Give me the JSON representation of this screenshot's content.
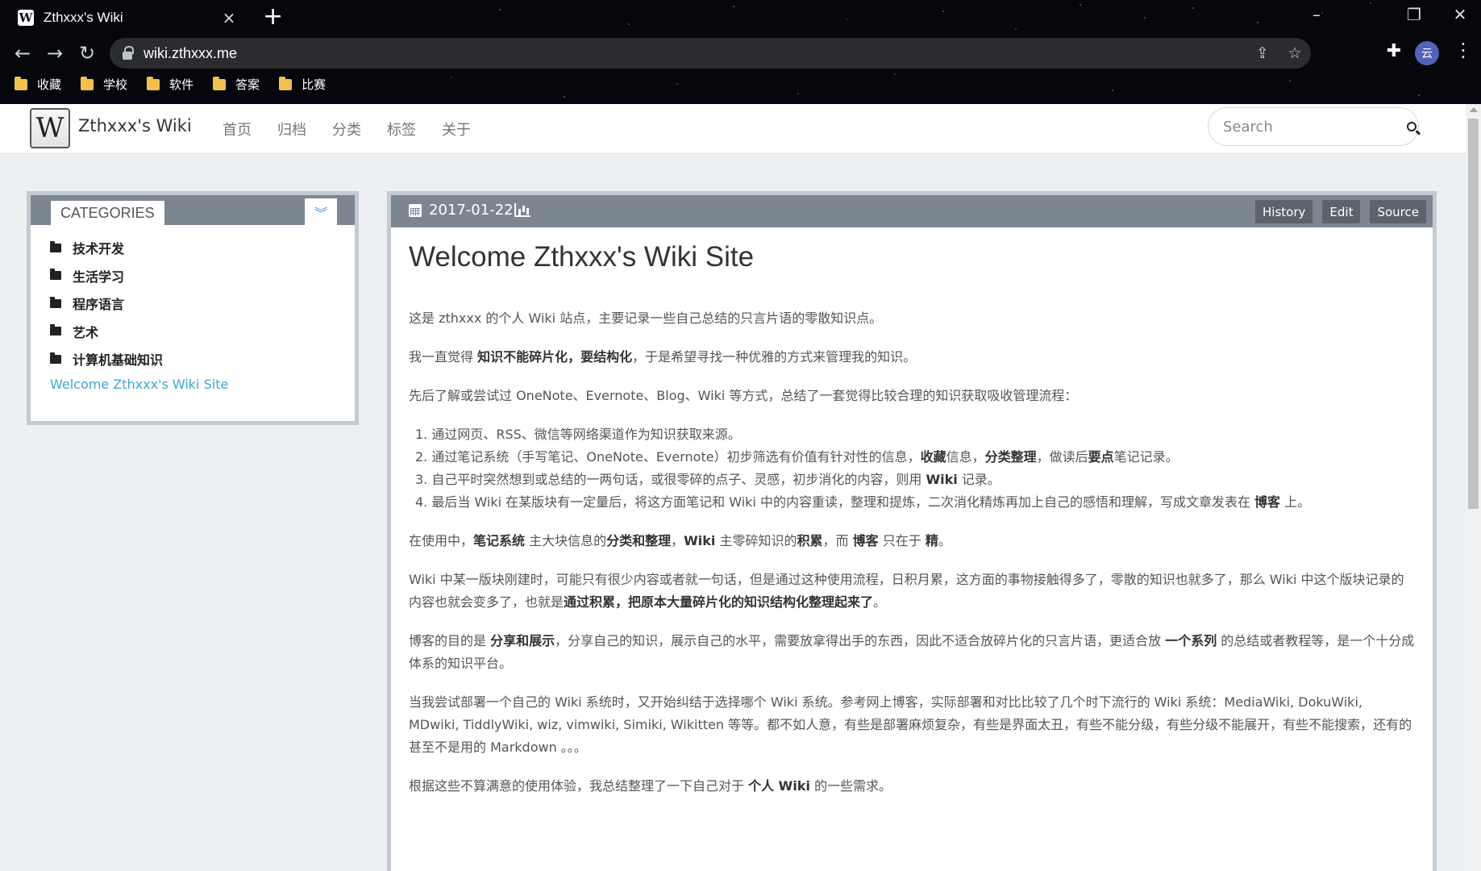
{
  "browser": {
    "tab_title": "Zthxxx's Wiki",
    "favicon": "W",
    "url": "wiki.zthxxx.me",
    "avatar_text": "云",
    "bookmarks": [
      "收藏",
      "学校",
      "软件",
      "答案",
      "比赛"
    ]
  },
  "header": {
    "logo": "W",
    "site_name": "Zthxxx's Wiki",
    "nav": [
      "首页",
      "归档",
      "分类",
      "标签",
      "关于"
    ],
    "search_placeholder": "Search"
  },
  "sidebar": {
    "title": "CATEGORIES",
    "categories": [
      "技术开发",
      "生活学习",
      "程序语言",
      "艺术",
      "计算机基础知识"
    ],
    "page_link": "Welcome Zthxxx's Wiki Site"
  },
  "article": {
    "date": "2017-01-22",
    "buttons": [
      "History",
      "Edit",
      "Source"
    ],
    "title": "Welcome Zthxxx's Wiki Site",
    "paragraphs": [
      "这是 zthxxx 的个人 Wiki 站点，主要记录一些自己总结的只言片语的零散知识点。",
      "我一直觉得 **知识不能碎片化，要结构化**，于是希望寻找一种优雅的方式来管理我的知识。",
      "先后了解或尝试过 OneNote、Evernote、Blog、Wiki 等方式，总结了一套觉得比较合理的知识获取吸收管理流程："
    ],
    "steps": [
      "通过网页、RSS、微信等网络渠道作为知识获取来源。",
      "通过笔记系统（手写笔记、OneNote、Evernote）初步筛选有价值有针对性的信息，**收藏**信息，**分类整理**，做读后**要点**笔记记录。",
      "自己平时突然想到或总结的一两句话，或很零碎的点子、灵感，初步消化的内容，则用 **Wiki** 记录。",
      "最后当 Wiki 在某版块有一定量后，将这方面笔记和 Wiki 中的内容重读，整理和提炼，二次消化精炼再加上自己的感悟和理解，写成文章发表在 **博客** 上。"
    ],
    "paragraphs_after": [
      "在使用中，**笔记系统** 主大块信息的**分类和整理**，**Wiki** 主零碎知识的**积累**，而 **博客** 只在于 **精**。",
      "Wiki 中某一版块刚建时，可能只有很少内容或者就一句话，但是通过这种使用流程，日积月累，这方面的事物接触得多了，零散的知识也就多了，那么 Wiki 中这个版块记录的内容也就会变多了，也就是**通过积累，把原本大量碎片化的知识结构化整理起来了**。",
      "博客的目的是 **分享和展示**，分享自己的知识，展示自己的水平，需要放拿得出手的东西，因此不适合放碎片化的只言片语，更适合放 **一个系列** 的总结或者教程等，是一个十分成体系的知识平台。",
      "当我尝试部署一个自己的 Wiki 系统时，又开始纠结于选择哪个 Wiki 系统。参考网上博客，实际部署和对比比较了几个时下流行的 Wiki 系统：MediaWiki, DokuWiki, MDwiki, TiddlyWiki, wiz, vimwiki, Simiki, Wikitten 等等。都不如人意，有些是部署麻烦复杂，有些是界面太丑，有些不能分级，有些分级不能展开，有些不能搜索，还有的甚至不是用的 Markdown 。。。",
      "根据这些不算满意的使用体验，我总结整理了一下自己对于 **个人 Wiki** 的一些需求。"
    ]
  }
}
